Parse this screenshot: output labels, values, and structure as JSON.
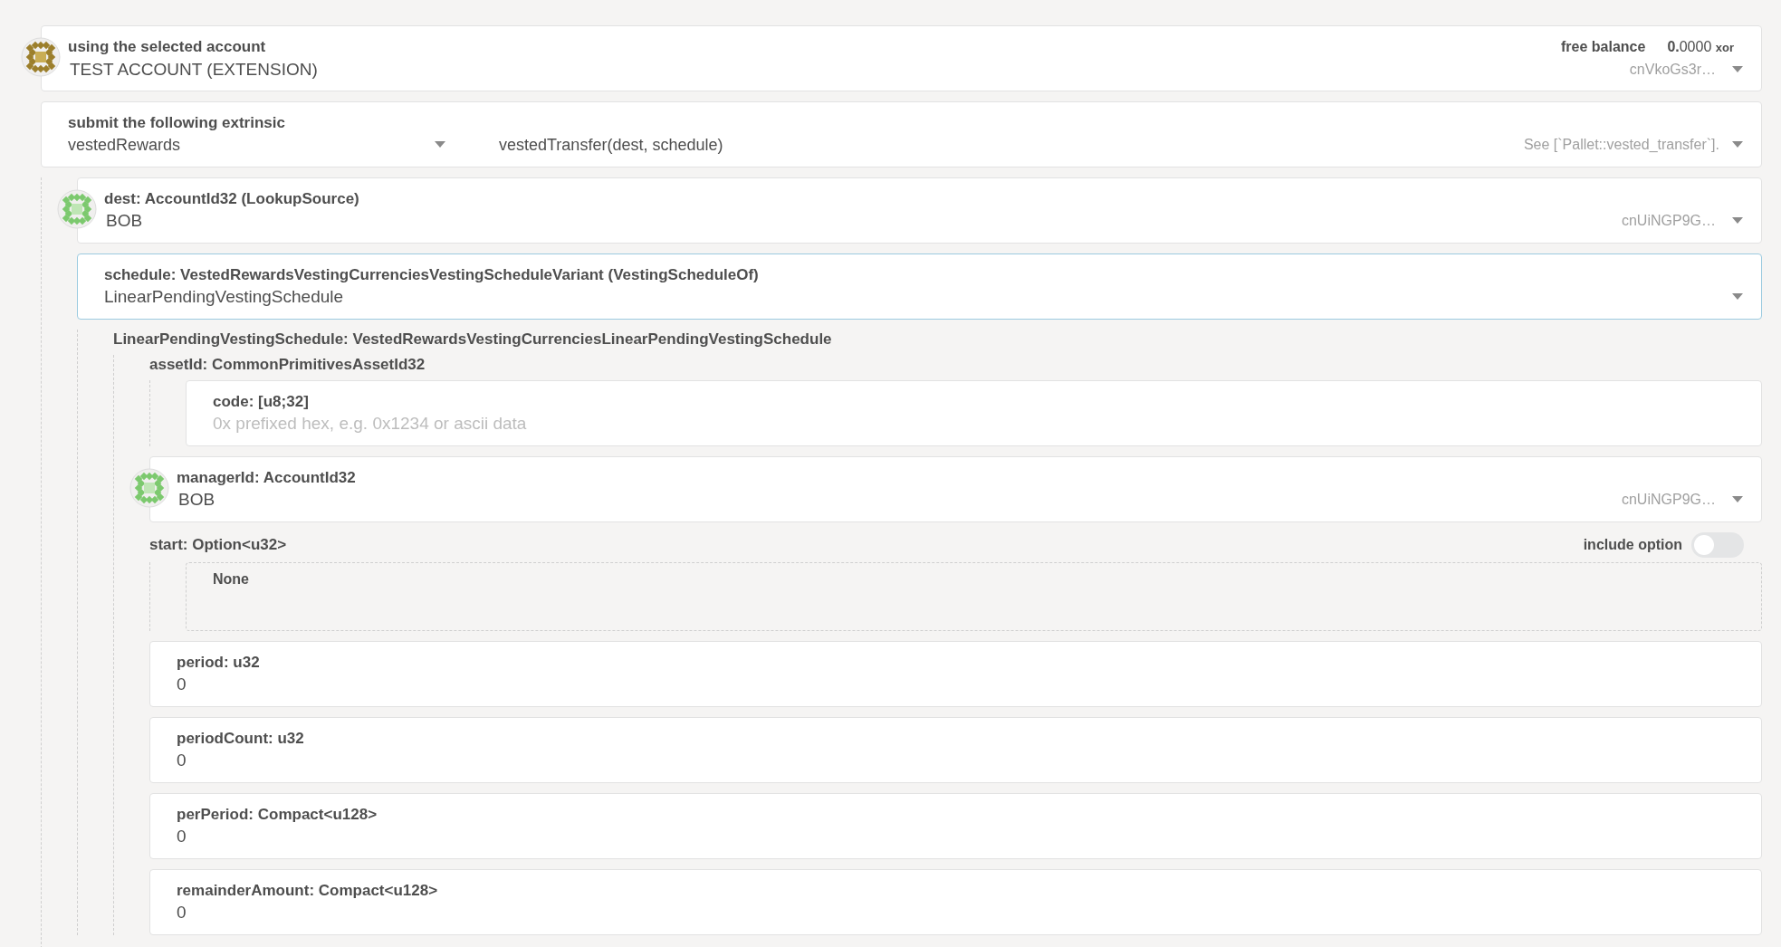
{
  "account_selector": {
    "label": "using the selected account",
    "value": "TEST ACCOUNT (EXTENSION)",
    "balance_label": "free balance",
    "balance_whole": "0.",
    "balance_decimals": "0000",
    "balance_unit": "xor",
    "address": "cnVkoGs3r…"
  },
  "extrinsic": {
    "label": "submit the following extrinsic",
    "section": "vestedRewards",
    "method": "vestedTransfer(dest, schedule)",
    "description": "See [`Pallet::vested_transfer`]."
  },
  "params": [
    {
      "kind": "account",
      "label": "dest: AccountId32 (LookupSource)",
      "value": "BOB",
      "address": "cnUiNGP9G…",
      "focused": false
    },
    {
      "kind": "enum",
      "label": "schedule: VestedRewardsVestingCurrenciesVestingScheduleVariant (VestingScheduleOf)",
      "value": "LinearPendingVestingSchedule",
      "focused": true,
      "children": [
        {
          "kind": "struct",
          "label": "LinearPendingVestingSchedule: VestedRewardsVestingCurrenciesLinearPendingVestingSchedule",
          "children": [
            {
              "kind": "struct",
              "label": "assetId: CommonPrimitivesAssetId32",
              "children": [
                {
                  "kind": "input",
                  "label": "code: [u8;32]",
                  "placeholder": "0x prefixed hex, e.g. 0x1234 or ascii data",
                  "focused": false
                }
              ]
            },
            {
              "kind": "account",
              "label": "managerId: AccountId32",
              "value": "BOB",
              "address": "cnUiNGP9G…",
              "focused": false
            },
            {
              "kind": "option",
              "label": "start: Option<u32>",
              "toggle_label": "include option",
              "on": false,
              "empty_text": "None"
            },
            {
              "kind": "input",
              "label": "period: u32",
              "value": "0",
              "focused": false
            },
            {
              "kind": "input",
              "label": "periodCount: u32",
              "value": "0",
              "focused": false
            },
            {
              "kind": "input",
              "label": "perPeriod: Compact<u128>",
              "value": "0",
              "focused": false
            },
            {
              "kind": "input",
              "label": "remainderAmount: Compact<u128>",
              "value": "0",
              "focused": false
            }
          ]
        }
      ]
    }
  ]
}
